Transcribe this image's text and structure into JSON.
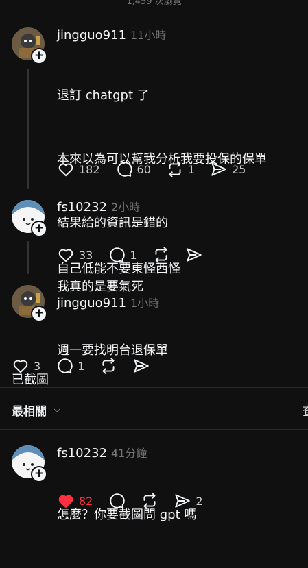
{
  "top_status": "1,459 次瀏覽",
  "posts": [
    {
      "username": "jingguo911",
      "time": "11小時",
      "lines": [
        "退訂 chatgpt 了",
        "本來以為可以幫我分析我要投保的保單",
        "結果給的資訊是錯的",
        "我真的是要氣死",
        "週一要找明台退保單"
      ],
      "likes": "182",
      "comments": "60",
      "reposts": "1",
      "shares": "25",
      "liked": false
    },
    {
      "username": "fs10232",
      "time": "2小時",
      "lines": [
        "自己低能不要東怪西怪"
      ],
      "likes": "33",
      "comments": "1",
      "reposts": "",
      "shares": "",
      "liked": false
    },
    {
      "username": "jingguo911",
      "time": "1小時",
      "lines": [
        "已截圖"
      ],
      "likes": "3",
      "comments": "1",
      "reposts": "",
      "shares": "",
      "liked": false
    }
  ],
  "sort": {
    "label": "最相關",
    "right_edge_text": "查"
  },
  "reply": {
    "username": "fs10232",
    "time": "41分鐘",
    "text": "怎麼？你要截圖問 gpt 嗎",
    "likes": "82",
    "comments": "",
    "reposts": "",
    "shares": "2",
    "liked": true
  },
  "colors": {
    "background": "#101010",
    "text": "#f3f5f7",
    "muted": "#777777",
    "like_red": "#ff3040"
  },
  "icons": [
    "plus-icon",
    "heart-icon",
    "comment-icon",
    "repost-icon",
    "share-icon",
    "chevron-down-icon"
  ]
}
